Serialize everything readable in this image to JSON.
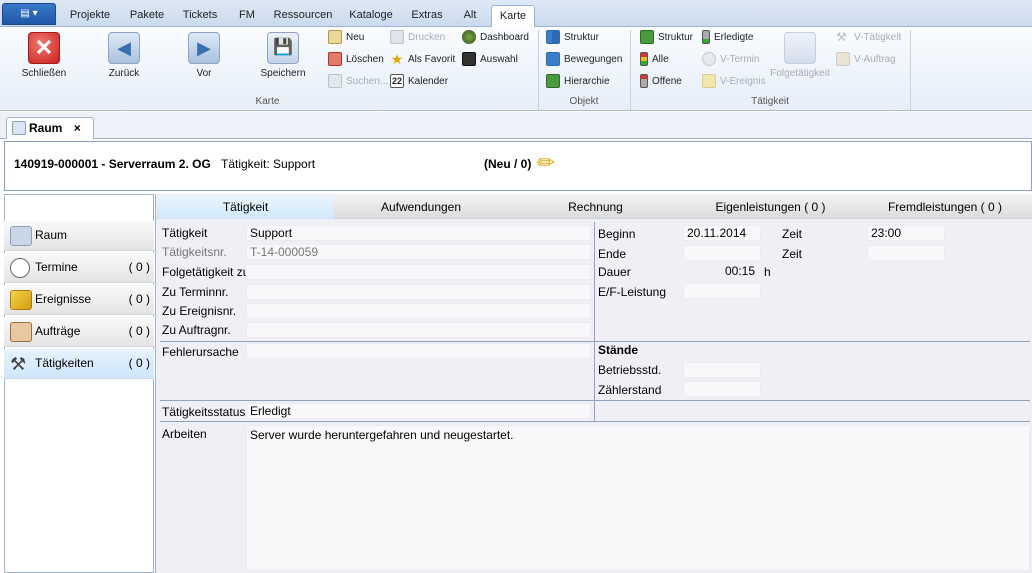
{
  "ribbon_tabs": [
    "Projekte",
    "Pakete",
    "Tickets",
    "FM",
    "Ressourcen",
    "Kataloge",
    "Extras",
    "Alt",
    "Karte"
  ],
  "ribbon": {
    "karte": {
      "label": "Karte",
      "schliessen": "Schließen",
      "zurueck": "Zurück",
      "vor": "Vor",
      "speichern": "Speichern",
      "neu": "Neu",
      "loeschen": "Löschen",
      "suchen": "Suchen...",
      "drucken": "Drucken",
      "als_favorit": "Als Favorit",
      "kalender": "Kalender",
      "dashboard": "Dashboard",
      "auswahl": "Auswahl",
      "calendar_day": "22"
    },
    "objekt": {
      "label": "Objekt",
      "struktur": "Struktur",
      "bewegungen": "Bewegungen",
      "hierarchie": "Hierarchie"
    },
    "taetigkeit": {
      "label": "Tätigkeit",
      "struktur": "Struktur",
      "alle": "Alle",
      "offene": "Offene",
      "erledigte": "Erledigte",
      "v_termin": "V-Termin",
      "v_ereignis": "V-Ereignis",
      "folgetaetigkeit": "Folgetätigkeit",
      "v_taetigkeit": "V-Tätigkeit",
      "v_auftrag": "V-Auftrag"
    }
  },
  "doc_tab": {
    "label": "Raum",
    "close": "×"
  },
  "header": {
    "title": "140919-000001 - Serverraum 2. OG",
    "subtitle": "Tätigkeit: Support",
    "status": "(Neu / 0)"
  },
  "nav": [
    {
      "label": "Raum",
      "count": ""
    },
    {
      "label": "Termine",
      "count": "( 0 )"
    },
    {
      "label": "Ereignisse",
      "count": "( 0 )"
    },
    {
      "label": "Aufträge",
      "count": "( 0 )"
    },
    {
      "label": "Tätigkeiten",
      "count": "( 0 )"
    }
  ],
  "content_tabs": [
    "Tätigkeit",
    "Aufwendungen",
    "Rechnung",
    "Eigenleistungen ( 0 )",
    "Fremdleistungen ( 0 )"
  ],
  "form": {
    "taetigkeit_label": "Tätigkeit",
    "taetigkeit_value": "Support",
    "taetigkeitsnr_label": "Tätigkeitsnr.",
    "taetigkeitsnr_value": "T-14-000059",
    "folgetaetigkeit_label": "Folgetätigkeit zu",
    "zu_terminnr_label": "Zu Terminnr.",
    "zu_ereignisnr_label": "Zu Ereignisnr.",
    "zu_auftragnr_label": "Zu Auftragnr.",
    "fehlerursache_label": "Fehlerursache",
    "status_label": "Tätigkeitsstatus",
    "status_value": "Erledigt",
    "arbeiten_label": "Arbeiten",
    "arbeiten_value": "Server wurde heruntergefahren und neugestartet.",
    "beginn_label": "Beginn",
    "beginn_value": "20.11.2014",
    "zeit1_label": "Zeit",
    "zeit1_value": "23:00",
    "ende_label": "Ende",
    "zeit2_label": "Zeit",
    "dauer_label": "Dauer",
    "dauer_value": "00:15",
    "dauer_unit": "h",
    "ef_label": "E/F-Leistung",
    "staende_label": "Stände",
    "betriebsstd_label": "Betriebsstd.",
    "zaehlerstand_label": "Zählerstand"
  },
  "colors": {
    "ribbon_blue": "#1f57a8",
    "close_red": "#d9302c",
    "selected_tab": "#cfe8fb"
  }
}
